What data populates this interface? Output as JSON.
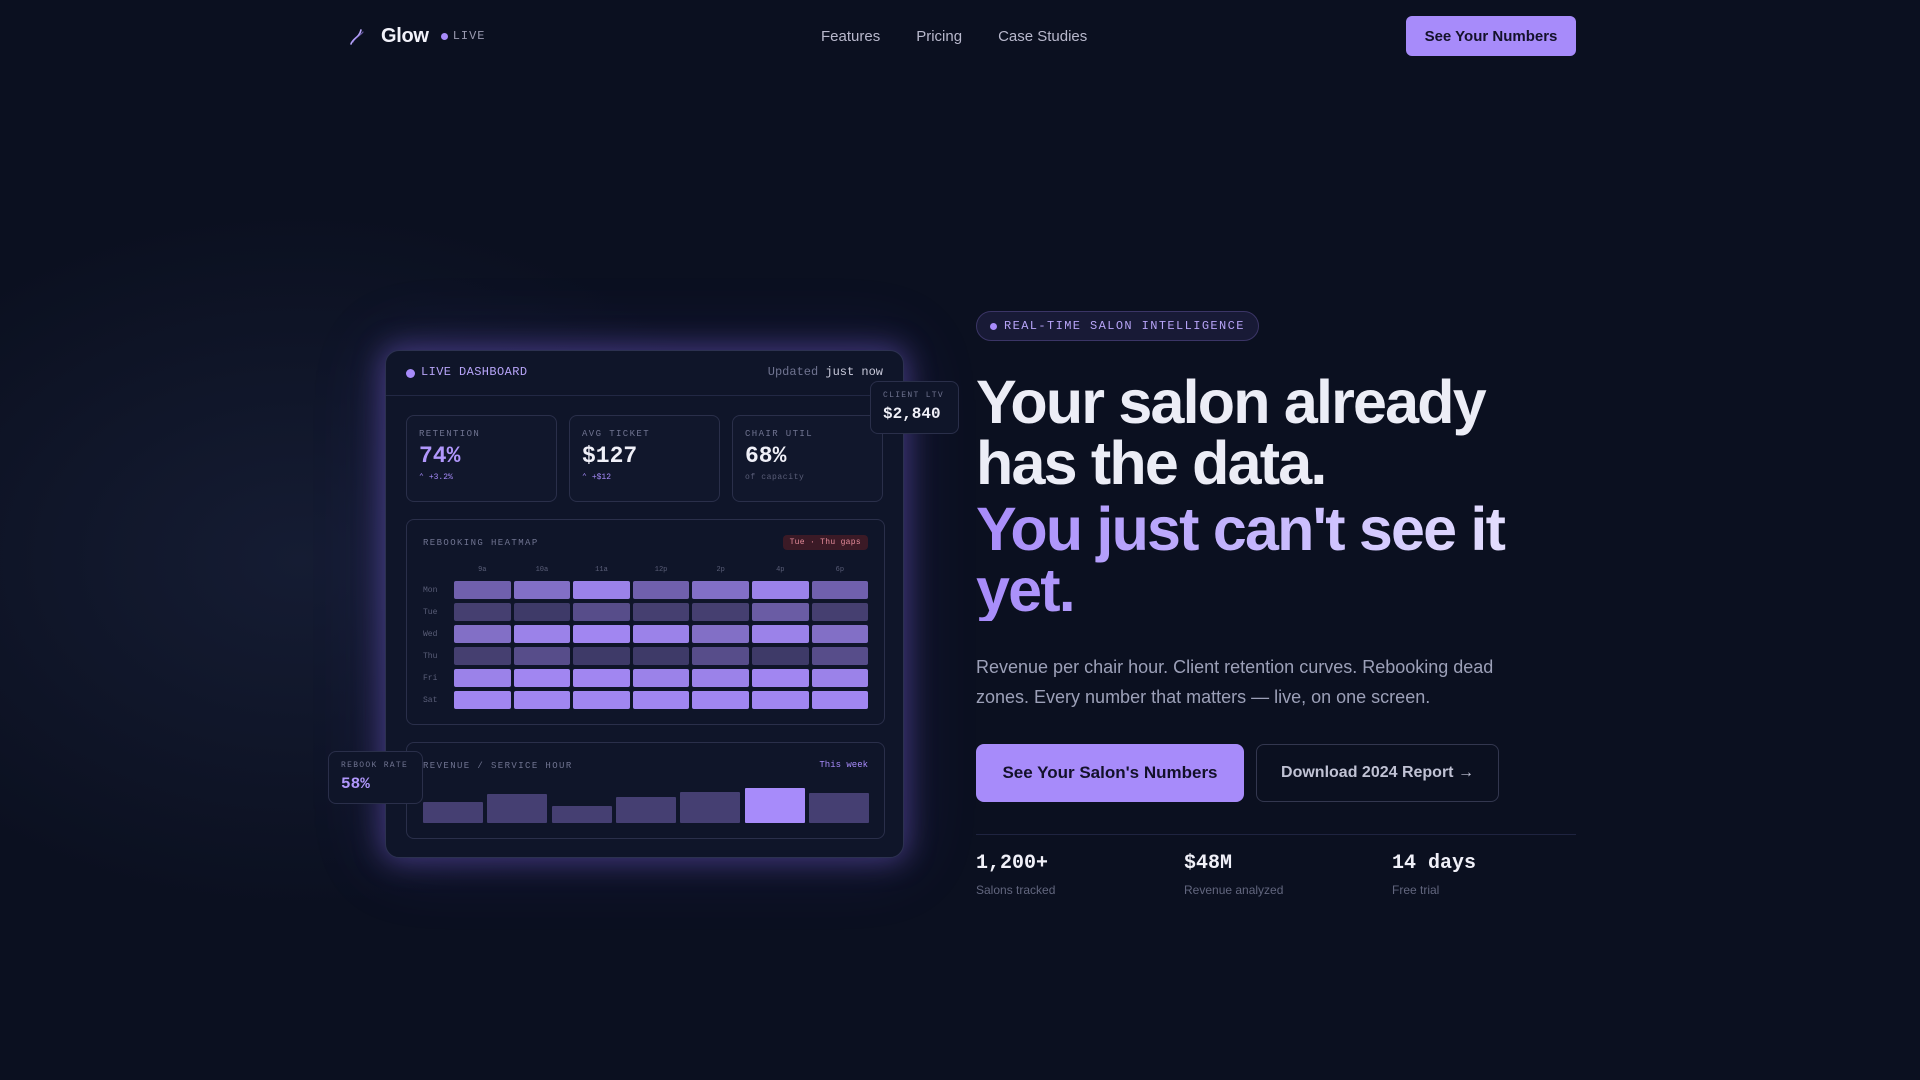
{
  "nav": {
    "brand": "Glow",
    "live_label": "LIVE",
    "links": [
      "Features",
      "Pricing",
      "Case Studies"
    ],
    "cta": "See Your Numbers"
  },
  "dashboard": {
    "title": "LIVE DASHBOARD",
    "updated_label": "Updated",
    "updated_value": "just now",
    "kpis": [
      {
        "label": "RETENTION",
        "value": "74%",
        "delta": "+3.2%"
      },
      {
        "label": "AVG TICKET",
        "value": "$127",
        "delta": "+$12"
      },
      {
        "label": "CHAIR UTIL",
        "value": "68%",
        "sub": "of capacity"
      }
    ],
    "heatmap": {
      "title": "REBOOKING HEATMAP",
      "badge": "Tue · Thu gaps",
      "columns": [
        "9a",
        "10a",
        "11a",
        "12p",
        "2p",
        "4p",
        "6p"
      ],
      "days": [
        "Mon",
        "Tue",
        "Wed",
        "Thu",
        "Fri",
        "Sat"
      ],
      "intensity": [
        [
          0.55,
          0.7,
          0.9,
          0.55,
          0.7,
          0.9,
          0.55
        ],
        [
          0.2,
          0.15,
          0.35,
          0.2,
          0.2,
          0.5,
          0.2
        ],
        [
          0.7,
          0.9,
          0.95,
          0.9,
          0.7,
          0.9,
          0.7
        ],
        [
          0.2,
          0.35,
          0.15,
          0.15,
          0.35,
          0.15,
          0.35
        ],
        [
          0.9,
          0.95,
          0.95,
          0.9,
          0.9,
          0.95,
          0.9
        ],
        [
          0.95,
          0.95,
          0.95,
          0.95,
          0.95,
          0.95,
          0.95
        ]
      ]
    },
    "revenue": {
      "title": "REVENUE / SERVICE HOUR",
      "period": "This week",
      "values": [
        0.55,
        0.75,
        0.45,
        0.68,
        0.82,
        0.92,
        0.8
      ],
      "highlight_index": 5
    },
    "floats": {
      "ltv_label": "CLIENT LTV",
      "ltv_value": "$2,840",
      "rebook_label": "REBOOK RATE",
      "rebook_value": "58%"
    }
  },
  "hero": {
    "badge": "REAL-TIME SALON INTELLIGENCE",
    "headline_line1": "Your salon already",
    "headline_line2": "has the data.",
    "headline_accent_line1": "You just can't see it",
    "headline_accent_line2": "yet.",
    "lede": "Revenue per chair hour. Client retention curves. Rebooking dead zones. Every number that matters — live, on one screen.",
    "primary_cta": "See Your Salon's Numbers",
    "secondary_cta": "Download 2024 Report →",
    "stats": [
      {
        "value": "1,200+",
        "label": "Salons tracked"
      },
      {
        "value": "$48M",
        "label": "Revenue analyzed"
      },
      {
        "value": "14 days",
        "label": "Free trial"
      }
    ]
  },
  "colors": {
    "accent": "#a78bfa",
    "background": "#0b1020",
    "panel": "#0f1529",
    "danger_badge": "#3b1a26"
  }
}
